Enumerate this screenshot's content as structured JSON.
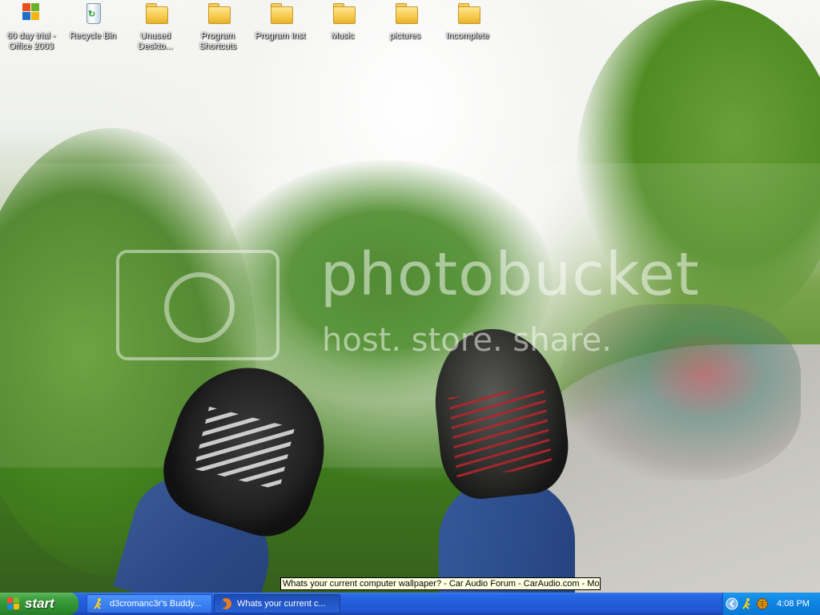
{
  "desktop": {
    "icons": [
      {
        "label": "60 day trial - Office 2003",
        "type": "office-icon"
      },
      {
        "label": "Recycle Bin",
        "type": "recycle-bin-icon"
      },
      {
        "label": "Unused Deskto...",
        "type": "folder-icon"
      },
      {
        "label": "Program Shortcuts",
        "type": "folder-icon"
      },
      {
        "label": "Program Inst",
        "type": "folder-icon"
      },
      {
        "label": "Music",
        "type": "folder-icon"
      },
      {
        "label": "pictures",
        "type": "folder-icon"
      },
      {
        "label": "Incomplete",
        "type": "folder-icon"
      }
    ],
    "watermark": {
      "brand": "photobucket",
      "tagline": "host. store. share."
    }
  },
  "tooltip": {
    "text": "Whats your current computer wallpaper? - Car Audio Forum - CarAudio.com - Mozil"
  },
  "taskbar": {
    "start_label": "start",
    "buttons": [
      {
        "label": "d3cromanc3r's Buddy...",
        "icon": "aim-running-man-icon",
        "active": false
      },
      {
        "label": "Whats your current c...",
        "icon": "firefox-icon",
        "active": true
      }
    ],
    "tray": {
      "icons": [
        "tray-collapse-arrow-icon",
        "aim-running-man-icon",
        "network-globe-icon"
      ],
      "clock": "4:08 PM"
    }
  },
  "colors": {
    "taskbar_blue": "#245edb",
    "start_green": "#3c9e3c",
    "tray_blue": "#0f86e3",
    "tooltip_bg": "#ffffe1"
  }
}
